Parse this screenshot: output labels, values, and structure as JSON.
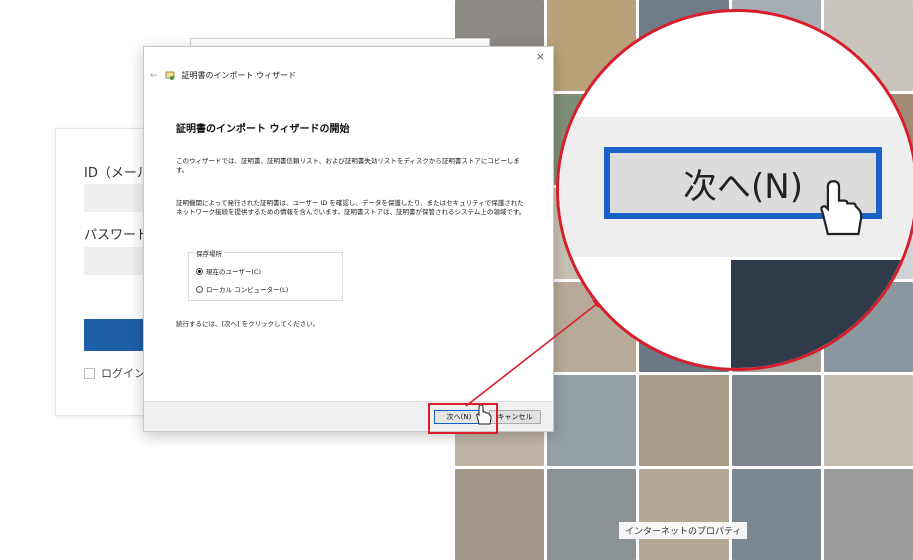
{
  "login": {
    "id_label": "ID（メールア",
    "password_label": "パスワード",
    "remember_label": "ログイン保"
  },
  "dialog": {
    "close_glyph": "×",
    "back_glyph": "←",
    "header_title": "証明書のインポート ウィザード",
    "title": "証明書のインポート ウィザードの開始",
    "paragraph1": "このウィザードでは、証明書、証明書信頼リスト、および証明書失効リストをディスクから証明書ストアにコピーします。",
    "paragraph2": "証明機関によって発行された証明書は、ユーザー ID を確認し、データを保護したり、またはセキュリティで保護されたネットワーク接続を提供するための情報を含んでいます。証明書ストアは、証明書が保管されるシステム上の領域です。",
    "store_legend": "保存場所",
    "options": [
      {
        "label": "現在のユーザー(C)",
        "selected": true
      },
      {
        "label": "ローカル コンピューター(L)",
        "selected": false
      }
    ],
    "footer_text": "続行するには、[次へ] をクリックしてください。",
    "next_label": "次へ(N)",
    "cancel_label": "キャンセル"
  },
  "magnifier": {
    "next_label": "次へ(N)"
  },
  "mosaic": {
    "caption": "インターネットのプロパティ"
  },
  "colors": {
    "highlight": "#d81e2a",
    "focus_border": "#1a62c9",
    "login_button": "#1f5fa8"
  }
}
